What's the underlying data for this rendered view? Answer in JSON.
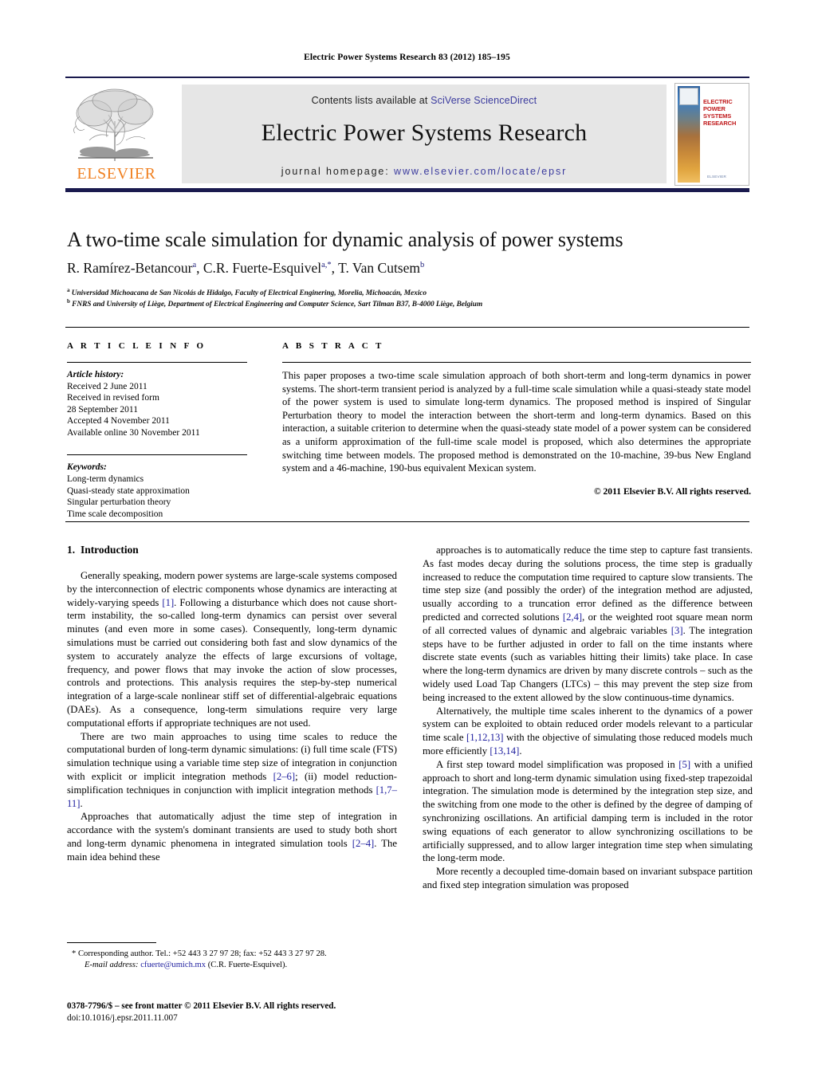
{
  "running_head": "Electric Power Systems Research 83 (2012) 185–195",
  "masthead": {
    "publisher_wordmark": "ELSEVIER",
    "contents_prefix": "Contents lists available at ",
    "contents_link": "SciVerse ScienceDirect",
    "journal_name": "Electric Power Systems Research",
    "homepage_prefix": "journal homepage: ",
    "homepage_url": "www.elsevier.com/locate/epsr",
    "cover": {
      "title_line1": "ELECTRIC POWER",
      "title_line2": "SYSTEMS RESEARCH",
      "footer_mark": "ELSEVIER",
      "title_color": "#c0191b"
    },
    "link_color": "#3b3b9e",
    "rule_color": "#1a1a4e",
    "wordmark_color": "#f08020"
  },
  "article": {
    "title": "A two-time scale simulation for dynamic analysis of power systems",
    "authors_html": "R. Ramírez-Betancour<sup>a</sup>, C.R. Fuerte-Esquivel<sup>a,</sup><sup>*</sup>, T. Van Cutsem<sup>b</sup>",
    "affiliation_a": "Universidad Michoacana de San Nicolás de Hidalgo, Faculty of Electrical Enginering, Morelia, Michoacán, Mexico",
    "affiliation_b": "FNRS and University of Liège, Department of Electrical Engineering and Computer Science, Sart Tilman B37, B-4000 Liège, Belgium"
  },
  "article_info": {
    "heading": "A R T I C L E   I N F O",
    "history_label": "Article history:",
    "history": [
      "Received 2 June 2011",
      "Received in revised form",
      "28 September 2011",
      "Accepted 4 November 2011",
      "Available online 30 November 2011"
    ],
    "keywords_label": "Keywords:",
    "keywords": [
      "Long-term dynamics",
      "Quasi-steady state approximation",
      "Singular perturbation theory",
      "Time scale decomposition"
    ]
  },
  "abstract": {
    "heading": "A B S T R A C T",
    "text": "This paper proposes a two-time scale simulation approach of both short-term and long-term dynamics in power systems. The short-term transient period is analyzed by a full-time scale simulation while a quasi-steady state model of the power system is used to simulate long-term dynamics. The proposed method is inspired of Singular Perturbation theory to model the interaction between the short-term and long-term dynamics. Based on this interaction, a suitable criterion to determine when the quasi-steady state model of a power system can be considered as a uniform approximation of the full-time scale model is proposed, which also determines the appropriate switching time between models. The proposed method is demonstrated on the 10-machine, 39-bus New England system and a 46-machine, 190-bus equivalent Mexican system.",
    "copyright": "© 2011 Elsevier B.V. All rights reserved."
  },
  "body": {
    "section_number": "1.",
    "section_title": "Introduction",
    "left_paragraphs": [
      "Generally speaking, modern power systems are large-scale systems composed by the interconnection of electric components whose dynamics are interacting at widely-varying speeds [1]. Following a disturbance which does not cause short-term instability, the so-called long-term dynamics can persist over several minutes (and even more in some cases). Consequently, long-term dynamic simulations must be carried out considering both fast and slow dynamics of the system to accurately analyze the effects of large excursions of voltage, frequency, and power flows that may invoke the action of slow processes, controls and protections. This analysis requires the step-by-step numerical integration of a large-scale nonlinear stiff set of differential-algebraic equations (DAEs). As a consequence, long-term simulations require very large computational efforts if appropriate techniques are not used.",
      "There are two main approaches to using time scales to reduce the computational burden of long-term dynamic simulations: (i) full time scale (FTS) simulation technique using a variable time step size of integration in conjunction with explicit or implicit integration methods [2–6]; (ii) model reduction-simplification techniques in conjunction with implicit integration methods [1,7–11].",
      "Approaches that automatically adjust the time step of integration in accordance with the system's dominant transients are used to study both short and long-term dynamic phenomena in integrated simulation tools [2–4]. The main idea behind these"
    ],
    "right_paragraphs": [
      "approaches is to automatically reduce the time step to capture fast transients. As fast modes decay during the solutions process, the time step is gradually increased to reduce the computation time required to capture slow transients. The time step size (and possibly the order) of the integration method are adjusted, usually according to a truncation error defined as the difference between predicted and corrected solutions [2,4], or the weighted root square mean norm of all corrected values of dynamic and algebraic variables [3]. The integration steps have to be further adjusted in order to fall on the time instants where discrete state events (such as variables hitting their limits) take place. In case where the long-term dynamics are driven by many discrete controls – such as the widely used Load Tap Changers (LTCs) – this may prevent the step size from being increased to the extent allowed by the slow continuous-time dynamics.",
      "Alternatively, the multiple time scales inherent to the dynamics of a power system can be exploited to obtain reduced order models relevant to a particular time scale [1,12,13] with the objective of simulating those reduced models much more efficiently [13,14].",
      "A first step toward model simplification was proposed in [5] with a unified approach to short and long-term dynamic simulation using fixed-step trapezoidal integration. The simulation mode is determined by the integration step size, and the switching from one mode to the other is defined by the degree of damping of synchronizing oscillations. An artificial damping term is included in the rotor swing equations of each generator to allow synchronizing oscillations to be artificially suppressed, and to allow larger integration time step when simulating the long-term mode.",
      "More recently a decoupled time-domain based on invariant subspace partition and fixed step integration simulation was proposed"
    ],
    "reference_color": "#1d1d9e"
  },
  "footer": {
    "corresponding_marker": "*",
    "corresponding_text": "Corresponding author. Tel.: +52 443 3 27 97 28; fax: +52 443 3 27 97 28.",
    "email_label": "E-mail address:",
    "email": "cfuerte@umich.mx",
    "email_owner": "(C.R. Fuerte-Esquivel).",
    "issn_line": "0378-7796/$ – see front matter © 2011 Elsevier B.V. All rights reserved.",
    "doi_label": "doi:",
    "doi": "10.1016/j.epsr.2011.11.007"
  }
}
